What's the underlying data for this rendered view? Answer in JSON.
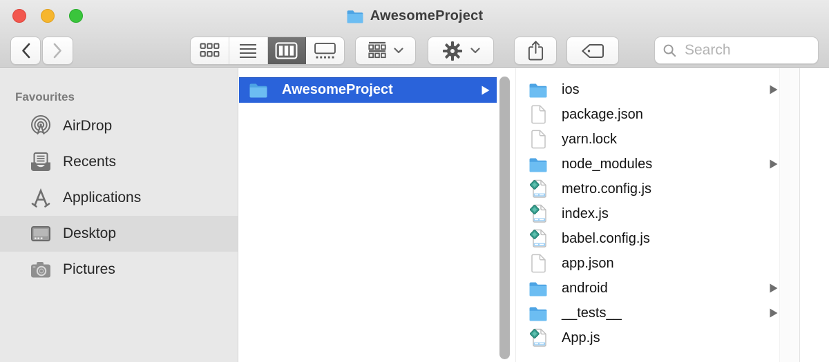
{
  "window": {
    "title": "AwesomeProject"
  },
  "toolbar": {
    "search_placeholder": "Search"
  },
  "sidebar": {
    "header": "Favourites",
    "items": [
      {
        "label": "AirDrop",
        "icon": "airdrop",
        "selected": false
      },
      {
        "label": "Recents",
        "icon": "recents",
        "selected": false
      },
      {
        "label": "Applications",
        "icon": "applications",
        "selected": false
      },
      {
        "label": "Desktop",
        "icon": "desktop",
        "selected": true
      },
      {
        "label": "Pictures",
        "icon": "pictures",
        "selected": false
      }
    ]
  },
  "columns": {
    "first": {
      "items": [
        {
          "name": "AwesomeProject",
          "type": "folder",
          "selected": true,
          "has_children": true
        }
      ]
    },
    "second": {
      "items": [
        {
          "name": "ios",
          "type": "folder",
          "has_children": true
        },
        {
          "name": "package.json",
          "type": "file",
          "has_children": false
        },
        {
          "name": "yarn.lock",
          "type": "file",
          "has_children": false
        },
        {
          "name": "node_modules",
          "type": "folder",
          "has_children": true
        },
        {
          "name": "metro.config.js",
          "type": "js",
          "has_children": false
        },
        {
          "name": "index.js",
          "type": "js",
          "has_children": false
        },
        {
          "name": "babel.config.js",
          "type": "js",
          "has_children": false
        },
        {
          "name": "app.json",
          "type": "file",
          "has_children": false
        },
        {
          "name": "android",
          "type": "folder",
          "has_children": true
        },
        {
          "name": "__tests__",
          "type": "folder",
          "has_children": true
        },
        {
          "name": "App.js",
          "type": "js",
          "has_children": false
        }
      ]
    },
    "third": {
      "items": []
    }
  },
  "colors": {
    "selection_blue": "#2a63da",
    "folder_blue": "#6cbdf2",
    "sidebar_bg": "#e8e8e8",
    "sidebar_selected": "#dbdbdb",
    "toolbar_selected_segment": "#696969"
  }
}
